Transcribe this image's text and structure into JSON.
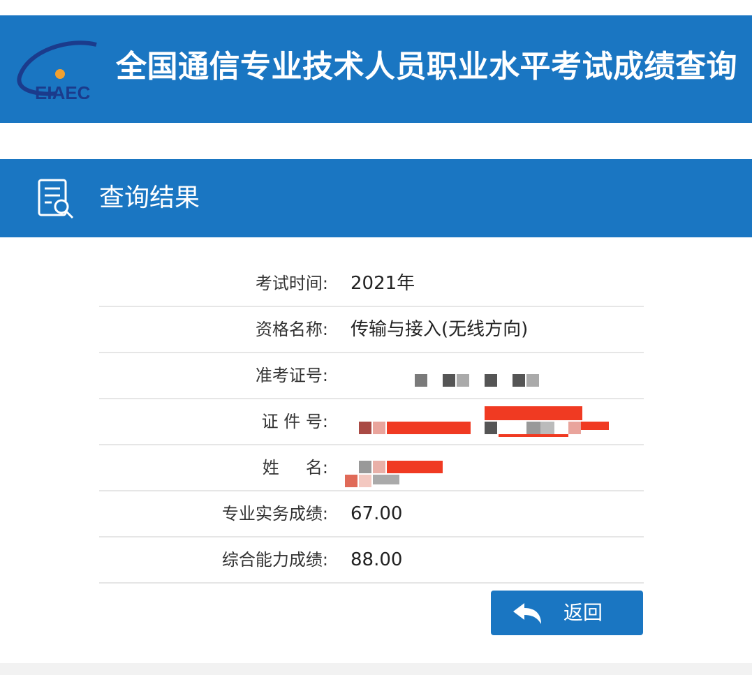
{
  "header": {
    "logo_text": "EIAEC",
    "title": "全国通信专业技术人员职业水平考试成绩查询"
  },
  "section": {
    "icon": "search-document-icon",
    "title": "查询结果"
  },
  "rows": [
    {
      "label": "考试时间:",
      "value": "2021年"
    },
    {
      "label": "资格名称:",
      "value": "传输与接入(无线方向)"
    },
    {
      "label": "准考证号:",
      "value": ""
    },
    {
      "label": "证 件 号:",
      "value": ""
    },
    {
      "label": "姓     名:",
      "value": ""
    },
    {
      "label": "专业实务成绩:",
      "value": "67.00"
    },
    {
      "label": "综合能力成绩:",
      "value": "88.00"
    }
  ],
  "back_button": {
    "icon": "reply-arrow-icon",
    "label": "返回"
  },
  "colors": {
    "brand_blue": "#1a76c2",
    "redaction_red": "#f03a22"
  }
}
